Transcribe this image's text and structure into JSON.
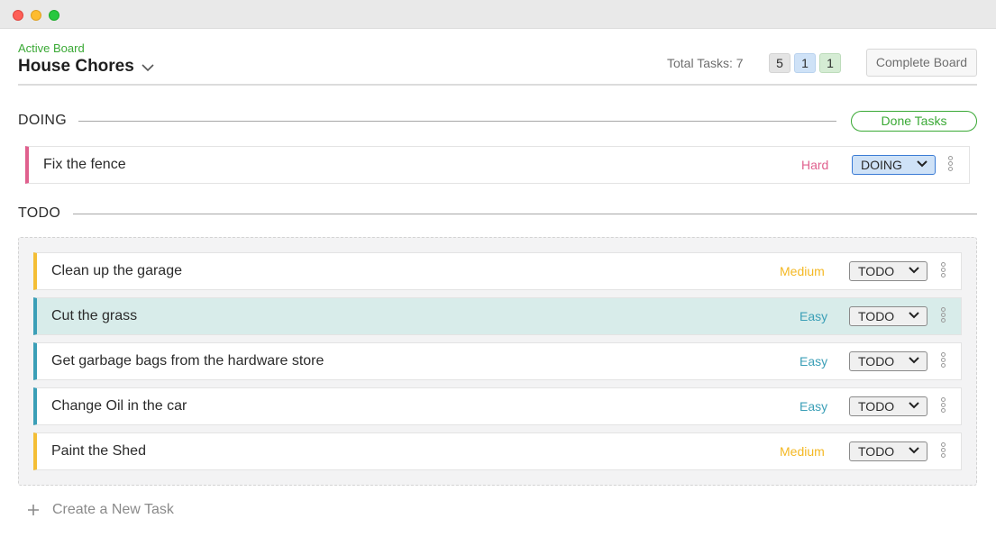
{
  "board": {
    "label": "Active Board",
    "title": "House Chores"
  },
  "summary": {
    "total_label": "Total Tasks: 7",
    "counts": [
      "5",
      "1",
      "1"
    ],
    "complete_button": "Complete Board"
  },
  "doing": {
    "title": "DOING",
    "done_button": "Done Tasks",
    "tasks": [
      {
        "name": "Fix the fence",
        "difficulty": "Hard",
        "status": "DOING"
      }
    ]
  },
  "todo": {
    "title": "TODO",
    "tasks": [
      {
        "name": "Clean up the garage",
        "difficulty": "Medium",
        "status": "TODO"
      },
      {
        "name": "Cut the grass",
        "difficulty": "Easy",
        "status": "TODO"
      },
      {
        "name": "Get garbage bags from the hardware store",
        "difficulty": "Easy",
        "status": "TODO"
      },
      {
        "name": "Change Oil in the car",
        "difficulty": "Easy",
        "status": "TODO"
      },
      {
        "name": "Paint the Shed",
        "difficulty": "Medium",
        "status": "TODO"
      }
    ]
  },
  "create_task": {
    "icon": "plus-icon",
    "label": "Create a New Task"
  },
  "colors": {
    "accent_green": "#3aa935",
    "hard": "#e0608e",
    "medium": "#f4be36",
    "easy": "#3b9fb7",
    "doing_status": "#cfe2f7",
    "highlight_row": "#d8ecea"
  }
}
